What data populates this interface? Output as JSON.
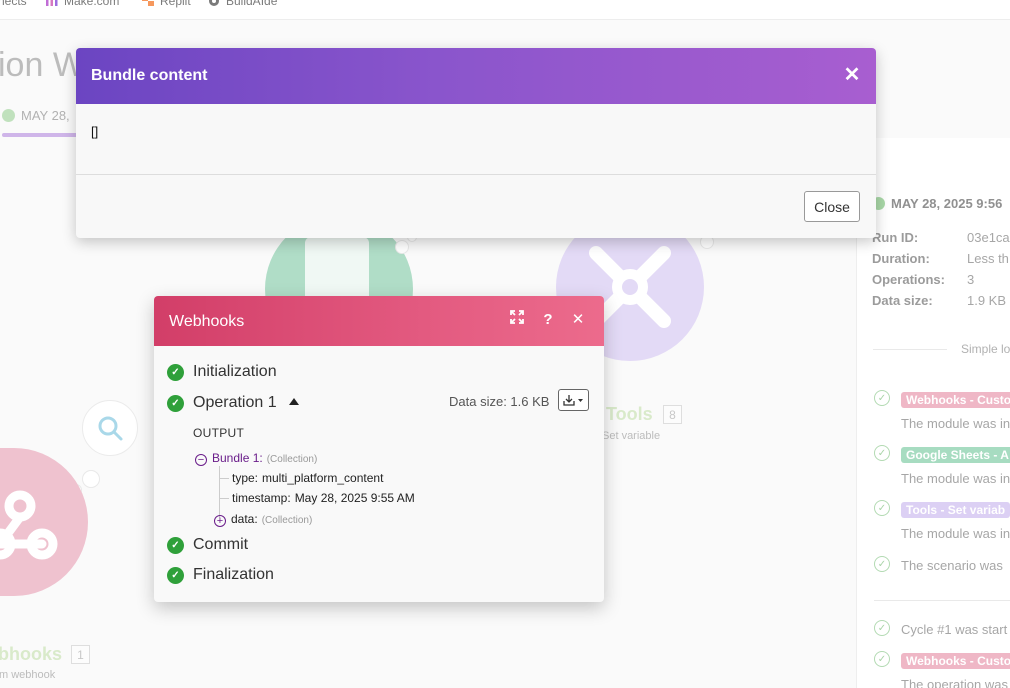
{
  "bookmarks": [
    {
      "label": "nects",
      "icon": "bookmark-icon"
    },
    {
      "label": "Make.com",
      "icon": "make-logo-icon"
    },
    {
      "label": "Replit",
      "icon": "replit-logo-icon"
    },
    {
      "label": "BuildAIde",
      "icon": "buildaide-logo-icon"
    }
  ],
  "background": {
    "title_fragment": "ion W",
    "tab_date": "MAY 28,",
    "modules": {
      "webhooks_label": "bhooks",
      "webhooks_count": "1",
      "webhooks_sub": "m webhook",
      "tools_label": "Tools",
      "tools_count": "8",
      "tools_sub": "Set variable"
    }
  },
  "log": {
    "header": "MAY 28, 2025 9:56",
    "run_id_label": "Run ID:",
    "run_id": "03e1ca",
    "duration_label": "Duration:",
    "duration": "Less th",
    "operations_label": "Operations:",
    "operations": "3",
    "data_size_label": "Data size:",
    "data_size": "1.9 KB",
    "separator": "Simple lo",
    "entries": [
      {
        "tag": "Webhooks - Custo",
        "text": "The module was in",
        "color": "#e691a8"
      },
      {
        "tag": "Google Sheets - A",
        "text": "The module was in",
        "color": "#79c9a0"
      },
      {
        "tag": "Tools - Set variab",
        "text": "The module was in",
        "color": "#c9b7ee"
      },
      {
        "text": "The scenario was"
      },
      {
        "text": "Cycle #1 was start"
      },
      {
        "tag": "Webhooks - Custo",
        "text": "The operation was",
        "color": "#e691a8"
      }
    ]
  },
  "bundle_modal": {
    "title": "Bundle content",
    "content": "[]",
    "close_label": "Close"
  },
  "inspector": {
    "title": "Webhooks",
    "steps": [
      "Initialization",
      "Operation 1",
      "Commit",
      "Finalization"
    ],
    "data_size": "Data size: 1.6 KB",
    "output_label": "OUTPUT",
    "bundle": {
      "label": "Bundle 1:",
      "tag": "(Collection)",
      "fields": [
        {
          "key": "type:",
          "value": "multi_platform_content"
        },
        {
          "key": "timestamp:",
          "value": "May 28, 2025 9:55 AM"
        }
      ],
      "data_key": "data:",
      "data_tag": "(Collection)"
    }
  },
  "colors": {
    "modal_header_start": "#6b45c2",
    "modal_header_end": "#a85ed0",
    "inspector_header_start": "#d23e68",
    "inspector_header_end": "#ec6b8c",
    "success_green": "#2fa03a"
  }
}
